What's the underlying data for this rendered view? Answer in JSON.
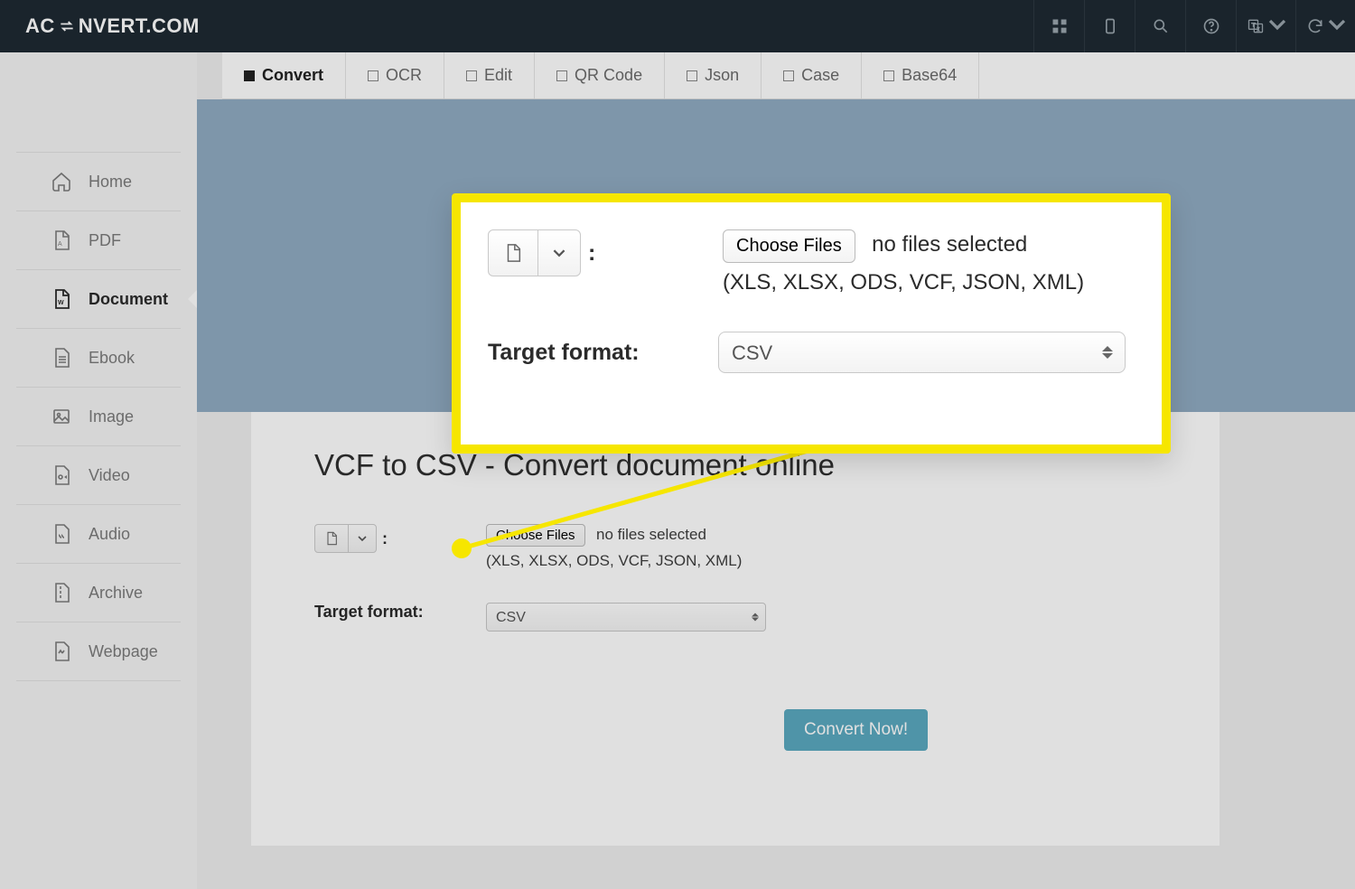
{
  "brand": {
    "left": "AC",
    "right": "NVERT.COM"
  },
  "sidebar": {
    "items": [
      {
        "label": "Home"
      },
      {
        "label": "PDF"
      },
      {
        "label": "Document"
      },
      {
        "label": "Ebook"
      },
      {
        "label": "Image"
      },
      {
        "label": "Video"
      },
      {
        "label": "Audio"
      },
      {
        "label": "Archive"
      },
      {
        "label": "Webpage"
      }
    ],
    "active_index": 2
  },
  "tabs": {
    "items": [
      {
        "label": "Convert"
      },
      {
        "label": "OCR"
      },
      {
        "label": "Edit"
      },
      {
        "label": "QR Code"
      },
      {
        "label": "Json"
      },
      {
        "label": "Case"
      },
      {
        "label": "Base64"
      }
    ],
    "active_index": 0
  },
  "page": {
    "title": "VCF to CSV - Convert document online",
    "source_toggle_colon": ":",
    "choose_files_label": "Choose Files",
    "no_files_label": "no files selected",
    "allowed_hint": "(XLS, XLSX, ODS, VCF, JSON, XML)",
    "target_format_label": "Target format:",
    "target_format_value": "CSV",
    "convert_button": "Convert Now!"
  },
  "overlay": {
    "choose_files_label": "Choose Files",
    "no_files_label": "no files selected",
    "allowed_hint": "(XLS, XLSX, ODS, VCF, JSON, XML)",
    "target_format_label": "Target format:",
    "target_format_value": "CSV",
    "colon": ":"
  }
}
